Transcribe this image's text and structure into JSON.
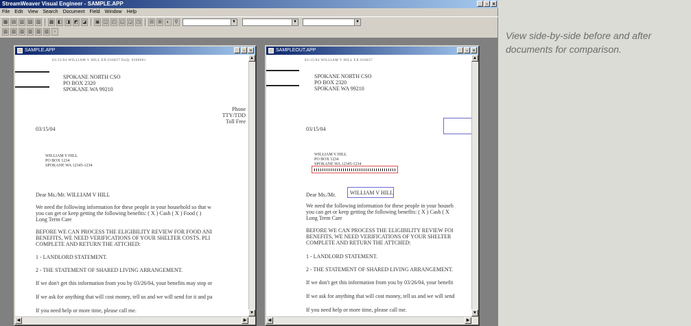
{
  "app": {
    "title": "StreamWeaver Visual Engineer - SAMPLE.APP",
    "window_buttons": [
      "_",
      "▫",
      "×"
    ]
  },
  "menubar": {
    "items": [
      "File",
      "Edit",
      "View",
      "Search",
      "Document",
      "Field",
      "Window",
      "Help"
    ]
  },
  "toolbar": {
    "icon_glyphs": [
      "▦",
      "▤",
      "▥",
      "▧",
      "▨",
      "▩",
      "◧",
      "◨",
      "◩",
      "◪",
      "▣",
      "◫",
      "◰",
      "◱",
      "◲",
      "◳",
      "⊟",
      "⊞",
      "◐",
      "⚲"
    ]
  },
  "toolbar2": {
    "icon_glyphs": [
      "▥",
      "▥",
      "▥",
      "▥",
      "▥",
      "▥",
      "◦"
    ]
  },
  "left_window": {
    "title": "SAMPLE.APP",
    "header_line": "03/15/04  WILLIAM V HILL                         EX:016837  DoQ: 9300001",
    "office_address": "SPOKANE NORTH CSO\nPO BOX 2320\nSPOKANE WA 99210",
    "contact_lines": "Phone\nTTY/TDD\nToll Free",
    "date": "03/15/04",
    "recipient_address": "WILLIAM V HILL\nPO BOX 1234\nSPOKANE WA 12345-1234",
    "salutation": "Dear Ms./Mr. WILLIAM V HILL",
    "para1_line1": "We need the following information for these people in your household so that w",
    "para1_line2": "you can get or keep getting the following benefits:  ( X ) Cash  ( X ) Food (  )",
    "para1_line3": "Long Term Care",
    "caps_line1": "BEFORE WE CAN PROCESS THE ELIGIBILITY REVIEW FOR FOOD ANI",
    "caps_line2": "BENEFITS, WE NEED VERIFICATIONS OF YOUR SHELTER COSTS. PLI",
    "caps_line3": "COMPLETE AND RETURN THE ATTCHED:",
    "item1": "1 - LANDLORD STATEMENT.",
    "item2": "2 - THE STATEMENT OF SHARED LIVING ARRANGEMENT.",
    "line_a": "If we don't get this information from you by 03/26/04, your benefits may stop or",
    "line_b": "If we ask for anything that will cost money, tell us and we will send for it and pa",
    "line_c": "If you need help or more time, please call me."
  },
  "right_window": {
    "title": "SAMPLEOUT.APP",
    "header_line": "03/15/04  WILLIAM V HILL                              EX:016837",
    "office_address": "SPOKANE NORTH CSO\nPO BOX 2320\nSPOKANE WA 99210",
    "date": "03/15/04",
    "recipient_address": "WILLIAM V HILL\nPO BOX 1234\nSPOKANE WA 12345-1234",
    "salutation_prefix": "Dear Ms./Mr.",
    "salutation_name": "WILLIAM V HILL",
    "para1_line1": "We need the following information for these people in your househ",
    "para1_line2": "you can get or keep getting the following benefits:  ( X ) Cash  ( X",
    "para1_line3": "Long Term Care",
    "caps_line1": "BEFORE WE CAN PROCESS THE ELIGIBILITY REVIEW FOI",
    "caps_line2": "BENEFITS, WE NEED VERIFICATIONS OF YOUR SHELTER",
    "caps_line3": "COMPLETE AND RETURN THE ATTCHED:",
    "item1": "1 - LANDLORD STATEMENT.",
    "item2": "2 - THE STATEMENT OF SHARED LIVING ARRANGEMENT.",
    "line_a": "If we don't get this information from you by 03/26/04, your benefit",
    "line_b": "If we ask for anything that will cost money, tell us and we will send",
    "line_c": "If you need help or more time, please call me."
  },
  "caption": "View side-by-side before and after documents for comparison."
}
